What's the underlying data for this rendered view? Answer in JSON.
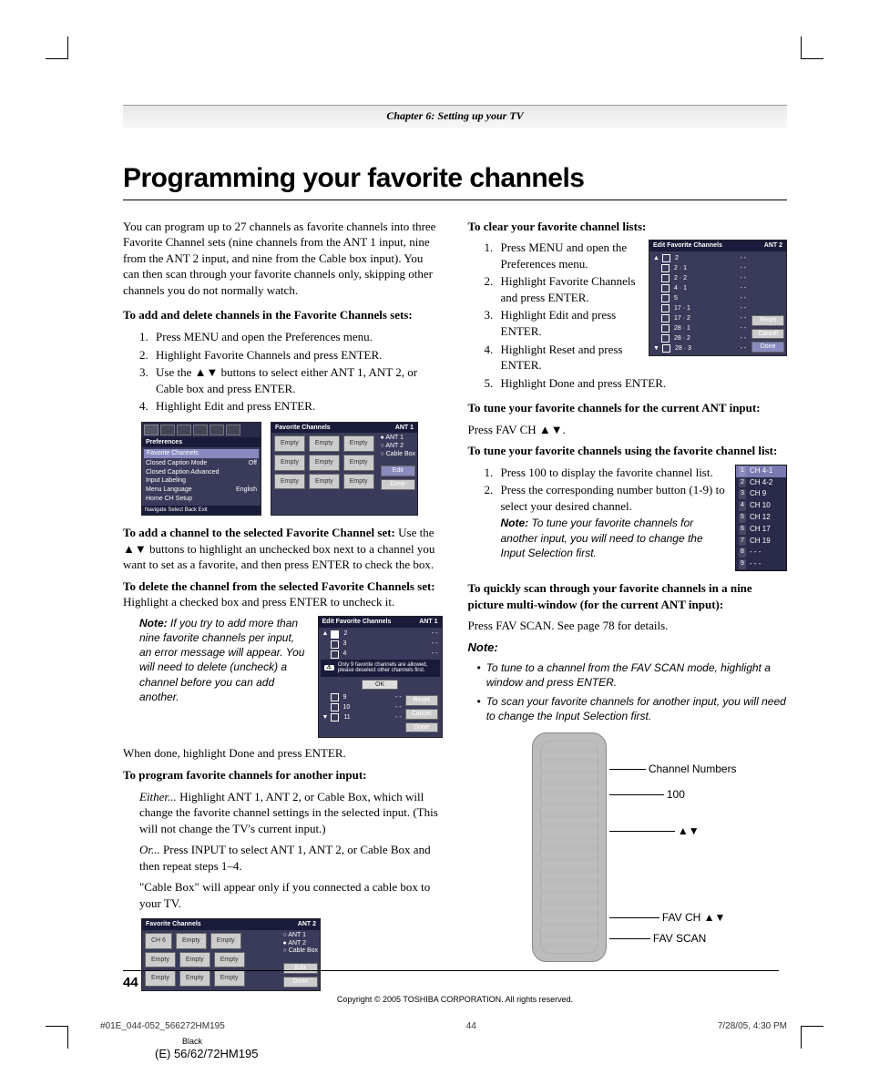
{
  "chapter": "Chapter 6: Setting up your TV",
  "title": "Programming your favorite channels",
  "left": {
    "intro": "You can program up to 27 channels as favorite channels into three Favorite Channel sets (nine channels from the ANT 1 input, nine from the ANT 2 input, and nine from the Cable box input). You can then scan through your favorite channels only, skipping other channels you do not normally watch.",
    "h_add_delete": "To add and delete channels in the Favorite Channels sets:",
    "steps_add": [
      "Press MENU and open the Preferences menu.",
      "Highlight Favorite Channels and press ENTER.",
      "Use the ▲▼ buttons to select either ANT 1, ANT 2, or Cable box and press ENTER.",
      "Highlight Edit and press ENTER."
    ],
    "h_add_channel": "To add a channel to the selected Favorite Channel set:",
    "add_channel_body": " Use the ▲▼ buttons to highlight an unchecked box next to a channel you want to set as a favorite, and then press ENTER to check the box.",
    "h_delete_channel": "To delete the channel from the selected Favorite Channels set:",
    "delete_channel_body": " Highlight a checked box and press ENTER to uncheck it.",
    "note1_label": "Note:",
    "note1": " If you try to add more than nine favorite channels per input, an error message will appear. You will need to delete (uncheck) a channel before you can add another.",
    "when_done": "When done, highlight Done and press ENTER.",
    "h_another_input": "To program favorite channels for another input:",
    "either_label": "Either...",
    "either_body": " Highlight ANT 1, ANT 2, or Cable Box, which will change the favorite channel settings in the selected input. (This will not change the TV's current input.)",
    "or_label": "Or...",
    "or_body": " Press INPUT to select ANT 1, ANT 2, or Cable Box and then repeat steps 1–4.",
    "cable_note": "\"Cable Box\" will appear only if you connected a cable box to your TV."
  },
  "right": {
    "h_clear": "To clear your favorite channel lists:",
    "steps_clear": [
      "Press MENU and open the Preferences menu.",
      "Highlight Favorite Channels and press ENTER.",
      "Highlight Edit and press ENTER.",
      "Highlight Reset and press ENTER.",
      "Highlight Done and press ENTER."
    ],
    "h_tune_current": "To tune your favorite channels for the current ANT input:",
    "tune_current_body": "Press FAV CH ▲▼.",
    "h_tune_list": "To tune your favorite channels using the favorite channel list:",
    "steps_tune": [
      "Press 100 to display the favorite channel list.",
      "Press the corresponding number button (1-9) to select your desired channel."
    ],
    "note2_label": "Note:",
    "note2": " To tune your favorite channels for another input, you will need to change the Input Selection first.",
    "h_scan": "To quickly scan through your favorite channels in a nine picture multi-window (for the current ANT input):",
    "scan_body": "Press FAV SCAN. See page 78 for details.",
    "note3_label": "Note:",
    "bullets": [
      "To tune to a channel from the FAV SCAN mode, highlight a window and press ENTER.",
      "To scan your favorite channels for another input, you will need to change the Input Selection first."
    ],
    "callouts": {
      "ch_num": "Channel Numbers",
      "b100": "100",
      "arrows": "▲▼",
      "favch": "FAV CH ▲▼",
      "favscan": "FAV SCAN"
    }
  },
  "osd": {
    "preferences": {
      "title": "Preferences",
      "section": "Favorite Channels",
      "rows": [
        [
          "Closed Caption Mode",
          "Off"
        ],
        [
          "Closed Caption Advanced",
          ""
        ],
        [
          "Input Labeling",
          ""
        ],
        [
          "Menu Language",
          "English"
        ],
        [
          "Home CH Setup",
          ""
        ]
      ],
      "footer": "Navigate    Select    Back    Exit"
    },
    "fav1": {
      "title": "Favorite Channels",
      "ant": "ANT 1",
      "cells": [
        "Empty",
        "Empty",
        "Empty",
        "Empty",
        "Empty",
        "Empty",
        "Empty",
        "Empty",
        "Empty"
      ],
      "radios": [
        "ANT 1",
        "ANT 2",
        "Cable Box"
      ],
      "radio_on": 0,
      "btns": [
        "Edit",
        "Done"
      ],
      "hl": 0
    },
    "edit1": {
      "title": "Edit Favorite Channels",
      "ant": "ANT 1",
      "rows_top": [
        [
          "2",
          "- -"
        ],
        [
          "3",
          "- -"
        ],
        [
          "4",
          "- -"
        ]
      ],
      "warn": "Only 9 favorite channels are allowed, please deselect other channels first.",
      "ok": "OK",
      "rows_bot": [
        [
          "9",
          "- -"
        ],
        [
          "10",
          "- -"
        ],
        [
          "11",
          "- -"
        ]
      ],
      "btns": [
        "Reset",
        "Cancel",
        "Done"
      ]
    },
    "fav2": {
      "title": "Favorite Channels",
      "ant": "ANT 2",
      "cells": [
        "CH 6",
        "Empty",
        "Empty",
        "Empty",
        "Empty",
        "Empty",
        "Empty",
        "Empty",
        "Empty"
      ],
      "radios": [
        "ANT 1",
        "ANT 2",
        "Cable Box"
      ],
      "radio_on": 1,
      "btns": [
        "Edit",
        "Done"
      ]
    },
    "edit2": {
      "title": "Edit Favorite Channels",
      "ant": "ANT 2",
      "rows": [
        [
          "2",
          "- -"
        ],
        [
          "2 · 1",
          "- -"
        ],
        [
          "2 · 2",
          "- -"
        ],
        [
          "4 · 1",
          "- -"
        ],
        [
          "5",
          "- -"
        ],
        [
          "17 · 1",
          "- -"
        ],
        [
          "17 · 2",
          "- -"
        ],
        [
          "28 · 1",
          "- -"
        ],
        [
          "28 · 2",
          "- -"
        ],
        [
          "28 · 3",
          "- -"
        ]
      ],
      "btns": [
        "Reset",
        "Cancel",
        "Done"
      ],
      "hl": 2
    },
    "favlist": [
      "CH 4-1",
      "CH 4-2",
      "CH 9",
      "CH 10",
      "CH 12",
      "CH 17",
      "CH 19",
      "- - -",
      "- - -"
    ]
  },
  "page_num": "44",
  "copyright": "Copyright © 2005 TOSHIBA CORPORATION. All rights reserved.",
  "slug_left": "#01E_044-052_566272HM195",
  "slug_mid": "44",
  "slug_right": "7/28/05, 4:30 PM",
  "black": "Black",
  "model": "(E) 56/62/72HM195"
}
